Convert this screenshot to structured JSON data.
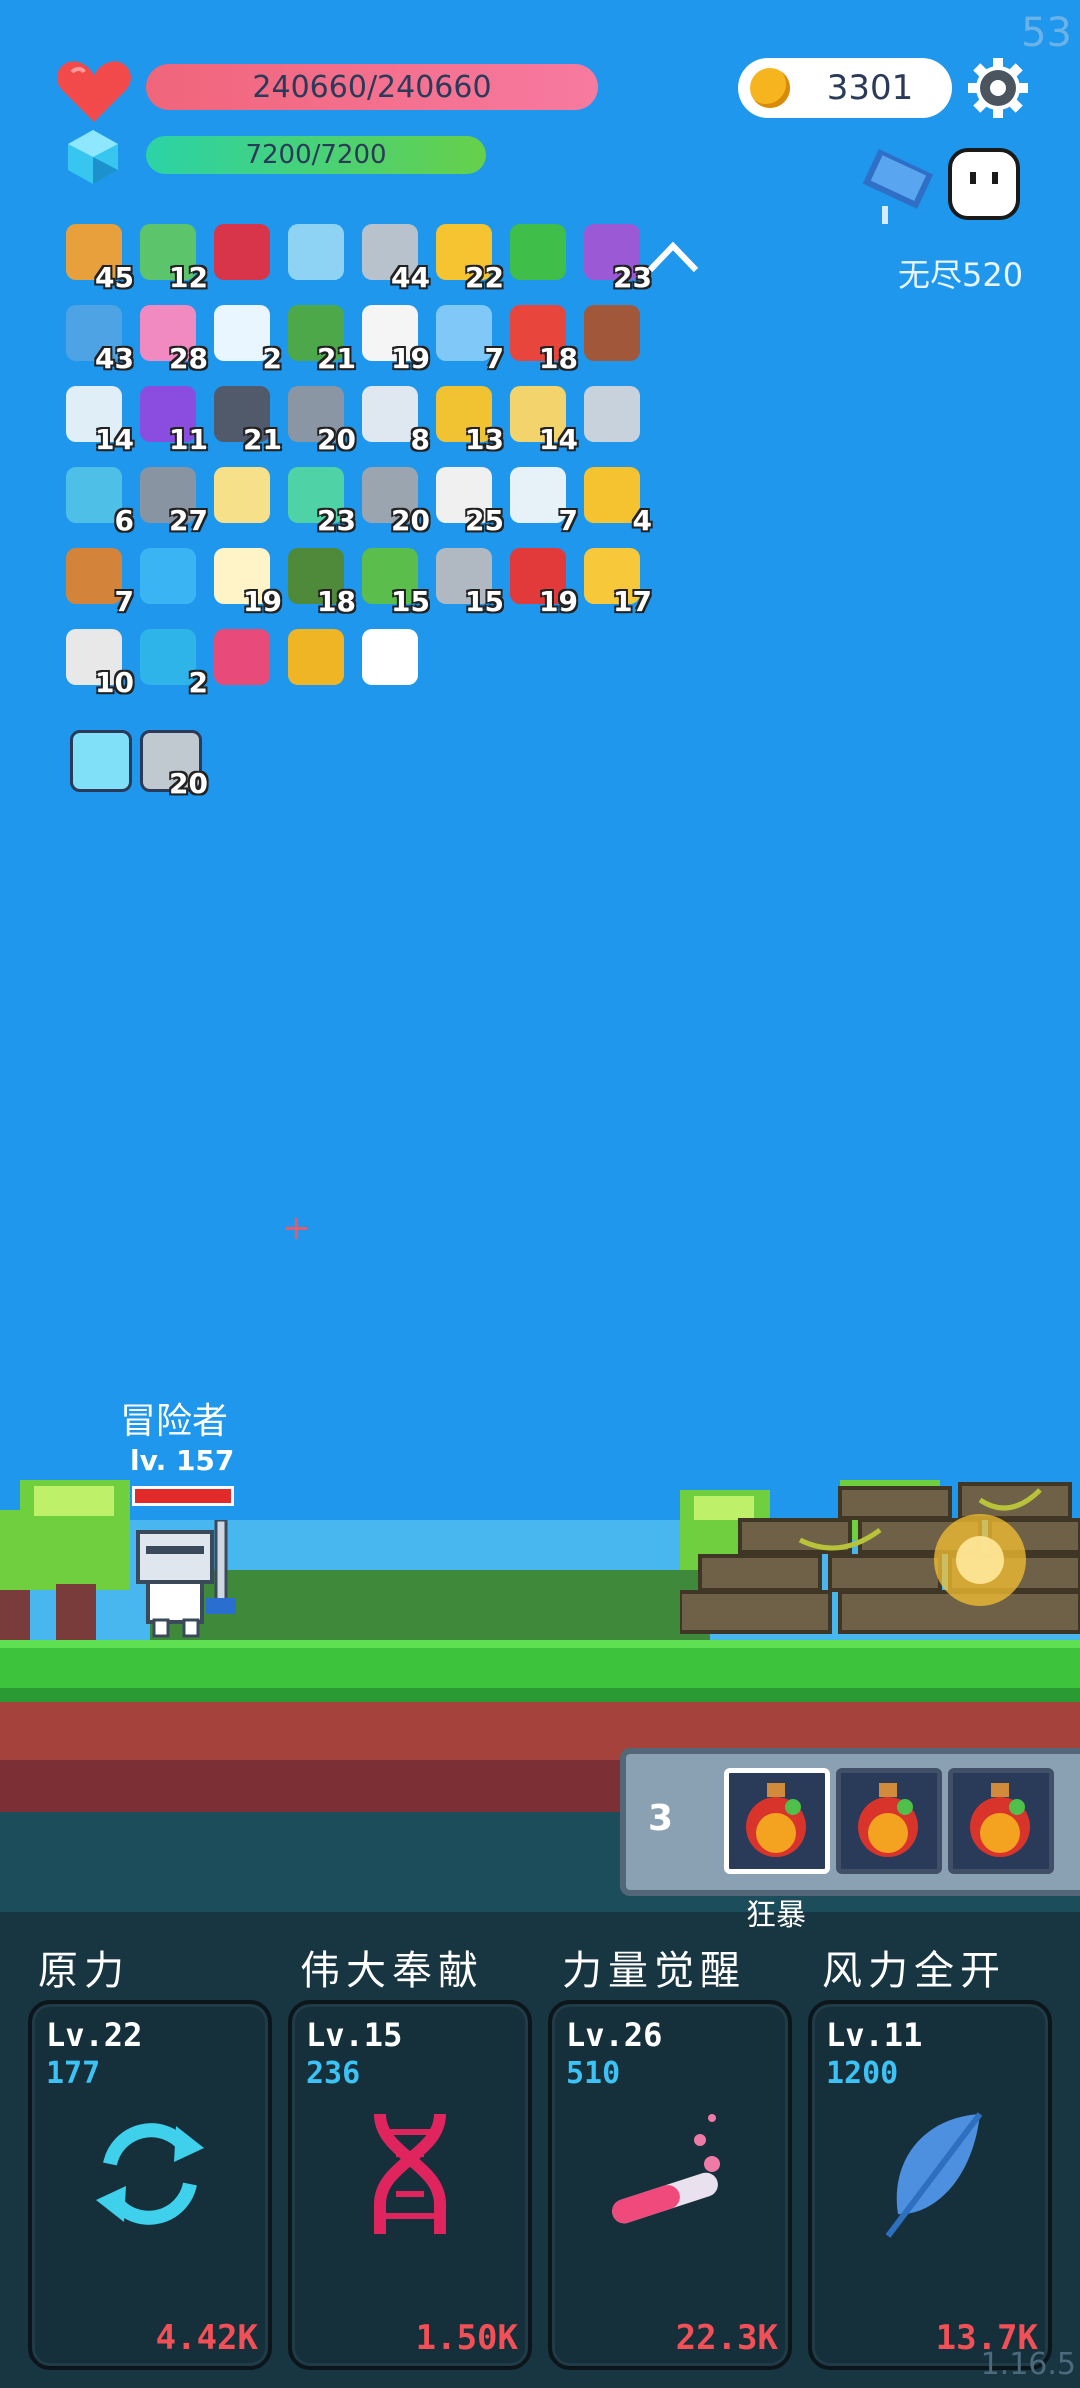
{
  "top": {
    "fps": "53",
    "hp_text": "240660/240660",
    "mp_text": "7200/7200",
    "coins": "3301",
    "endless_label": "无尽520"
  },
  "buffs": [
    {
      "icon": "spellbook-icon",
      "count": "45",
      "color": "#e8a03c"
    },
    {
      "icon": "cash-heart-icon",
      "count": "12",
      "color": "#5cc46a"
    },
    {
      "icon": "magnet-icon",
      "count": "",
      "color": "#d8344a"
    },
    {
      "icon": "magnifier-icon",
      "count": "",
      "color": "#8fd3f4"
    },
    {
      "icon": "sword-icon",
      "count": "44",
      "color": "#b8c2cc"
    },
    {
      "icon": "crown-icon",
      "count": "22",
      "color": "#f6c431"
    },
    {
      "icon": "green-card-icon",
      "count": "",
      "color": "#3fbf4a"
    },
    {
      "icon": "purple-box-icon",
      "count": "23",
      "color": "#9b59d6"
    },
    {
      "icon": "star-card-icon",
      "count": "43",
      "color": "#4da3e3"
    },
    {
      "icon": "ice-cream-icon",
      "count": "28",
      "color": "#f08ac0"
    },
    {
      "icon": "cloud-icon",
      "count": "2",
      "color": "#eaf6ff"
    },
    {
      "icon": "turtle-shell-icon",
      "count": "21",
      "color": "#4da84a"
    },
    {
      "icon": "ghost-icon",
      "count": "19",
      "color": "#f5f5f5"
    },
    {
      "icon": "potion-flask-icon",
      "count": "7",
      "color": "#7fc8f8"
    },
    {
      "icon": "gift-box-icon",
      "count": "18",
      "color": "#e8453c"
    },
    {
      "icon": "treasure-chest-icon",
      "count": "",
      "color": "#a0573a"
    },
    {
      "icon": "rain-cloud-icon",
      "count": "14",
      "color": "#e0eef8"
    },
    {
      "icon": "crystal-ball-icon",
      "count": "11",
      "color": "#8a4de0"
    },
    {
      "icon": "bat-icon",
      "count": "21",
      "color": "#505a6a"
    },
    {
      "icon": "spiked-ball-icon",
      "count": "20",
      "color": "#8a96a4"
    },
    {
      "icon": "envelope-icon",
      "count": "8",
      "color": "#dfe8f0"
    },
    {
      "icon": "ring-icon",
      "count": "13",
      "color": "#f1c232"
    },
    {
      "icon": "note-pencil-icon",
      "count": "14",
      "color": "#f3d36b"
    },
    {
      "icon": "sickle-icon",
      "count": "",
      "color": "#c7d2dc"
    },
    {
      "icon": "target-icon",
      "count": "6",
      "color": "#4ec0e8"
    },
    {
      "icon": "elephant-icon",
      "count": "27",
      "color": "#8894a2"
    },
    {
      "icon": "halo-wings-icon",
      "count": "",
      "color": "#f6e08a"
    },
    {
      "icon": "green-spirit-icon",
      "count": "23",
      "color": "#4fd3a6"
    },
    {
      "icon": "meteor-icon",
      "count": "20",
      "color": "#9aa5b0"
    },
    {
      "icon": "dice-icon",
      "count": "25",
      "color": "#f0f0f0"
    },
    {
      "icon": "light-bulb-icon",
      "count": "7",
      "color": "#e6f1f8"
    },
    {
      "icon": "magic-wand-icon",
      "count": "4",
      "color": "#f5c330"
    },
    {
      "icon": "crossbow-icon",
      "count": "7",
      "color": "#d4843a"
    },
    {
      "icon": "chat-bubble-icon",
      "count": "",
      "color": "#3ab4f2"
    },
    {
      "icon": "fried-egg-icon",
      "count": "19",
      "color": "#fff4c8"
    },
    {
      "icon": "grenade-icon",
      "count": "18",
      "color": "#4f8a3a"
    },
    {
      "icon": "green-goblin-icon",
      "count": "15",
      "color": "#5bbd4c"
    },
    {
      "icon": "compass-icon",
      "count": "15",
      "color": "#b0b8c2"
    },
    {
      "icon": "mushroom-icon",
      "count": "19",
      "color": "#e23a3a"
    },
    {
      "icon": "sun-glow-icon",
      "count": "17",
      "color": "#f6c83a"
    },
    {
      "icon": "playing-card-icon",
      "count": "10",
      "color": "#e8e8e8"
    },
    {
      "icon": "blue-gem-icon",
      "count": "2",
      "color": "#2eb4e8"
    },
    {
      "icon": "jam-jar-icon",
      "count": "",
      "color": "#e84a7a"
    },
    {
      "icon": "gold-coins-stack-icon",
      "count": "",
      "color": "#f0b525"
    },
    {
      "icon": "white-flower-icon",
      "count": "",
      "color": "#ffffff"
    }
  ],
  "extra_buffs": [
    {
      "icon": "glowing-lamp-icon",
      "count": "",
      "color": "#7fe0f8"
    },
    {
      "icon": "striped-block-icon",
      "count": "20",
      "color": "#c0c8d0"
    }
  ],
  "float_text": "+",
  "hero": {
    "name": "冒险者",
    "level": "lv. 157"
  },
  "potion_bar": {
    "count": "3",
    "label": "狂暴"
  },
  "skills": [
    {
      "title": "原力",
      "lv": "Lv.22",
      "cost": "177",
      "value": "4.42K",
      "icon": "refresh-cycle-icon"
    },
    {
      "title": "伟大奉献",
      "lv": "Lv.15",
      "cost": "236",
      "value": "1.50K",
      "icon": "dna-helix-icon"
    },
    {
      "title": "力量觉醒",
      "lv": "Lv.26",
      "cost": "510",
      "value": "22.3K",
      "icon": "test-tube-icon"
    },
    {
      "title": "风力全开",
      "lv": "Lv.11",
      "cost": "1200",
      "value": "13.7K",
      "icon": "feather-icon"
    }
  ],
  "version": "1.16.5"
}
